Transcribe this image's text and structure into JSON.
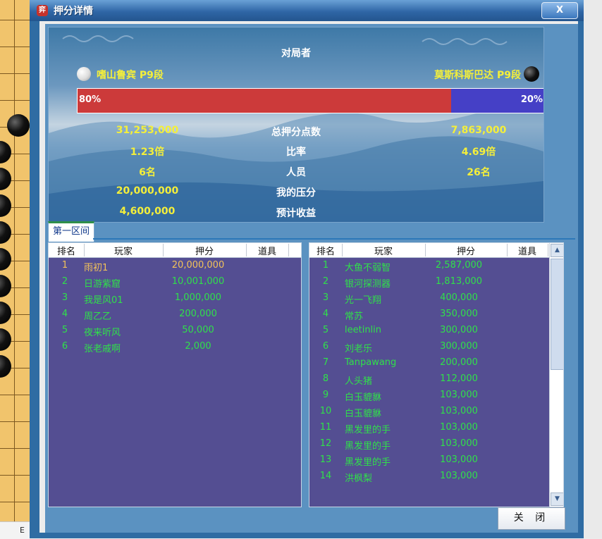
{
  "board": {
    "status_letter": "E"
  },
  "dialog": {
    "title": "押分详情",
    "title_icon_glyph": "弈",
    "close_x": "X",
    "close_button": "关 闭"
  },
  "summary": {
    "header": "对局者",
    "player_white": "嗜山鲁宾 P9段",
    "player_black": "莫斯科斯巴达 P9段",
    "ratio_left": 0.8,
    "ratio_left_label": "80%",
    "ratio_right_label": "20%",
    "rows": [
      {
        "label": "总押分点数",
        "left": "31,253,000",
        "right": "7,863,000"
      },
      {
        "label": "比率",
        "left": "1.23倍",
        "right": "4.69倍"
      },
      {
        "label": "人员",
        "left": "6名",
        "right": "26名"
      },
      {
        "label": "我的压分",
        "left": "20,000,000",
        "right": ""
      },
      {
        "label": "预计收益",
        "left": "4,600,000",
        "right": ""
      }
    ],
    "colors": {
      "bar_left": "#cc3a3a",
      "bar_right": "#4540c6",
      "value_text": "#f4ef3a"
    }
  },
  "tab": {
    "label": "第一区间"
  },
  "columns": {
    "rank": "排名",
    "player": "玩家",
    "bet": "押分",
    "item": "道具"
  },
  "left_table": [
    {
      "rank": "1",
      "name": "雨初1",
      "bet": "20,000,000",
      "highlight": true
    },
    {
      "rank": "2",
      "name": "日游紫窟",
      "bet": "10,001,000"
    },
    {
      "rank": "3",
      "name": "我是风01",
      "bet": "1,000,000"
    },
    {
      "rank": "4",
      "name": "周乙乙",
      "bet": "200,000"
    },
    {
      "rank": "5",
      "name": "夜来听风",
      "bet": "50,000"
    },
    {
      "rank": "6",
      "name": "张老戚啊",
      "bet": "2,000"
    }
  ],
  "right_table": [
    {
      "rank": "1",
      "name": "大鱼不弱智",
      "bet": "2,587,000"
    },
    {
      "rank": "2",
      "name": "银河探测器",
      "bet": "1,813,000"
    },
    {
      "rank": "3",
      "name": "光一飞翔",
      "bet": "400,000"
    },
    {
      "rank": "4",
      "name": "常苏",
      "bet": "350,000"
    },
    {
      "rank": "5",
      "name": "leetinlin",
      "bet": "300,000"
    },
    {
      "rank": "6",
      "name": "刘老乐",
      "bet": "300,000"
    },
    {
      "rank": "7",
      "name": "Tanpawang",
      "bet": "200,000"
    },
    {
      "rank": "8",
      "name": "人头猪",
      "bet": "112,000"
    },
    {
      "rank": "9",
      "name": "白玉貔貅",
      "bet": "103,000"
    },
    {
      "rank": "10",
      "name": "白玉貔貅",
      "bet": "103,000"
    },
    {
      "rank": "11",
      "name": "黑发里的手",
      "bet": "103,000"
    },
    {
      "rank": "12",
      "name": "黑发里的手",
      "bet": "103,000"
    },
    {
      "rank": "13",
      "name": "黑发里的手",
      "bet": "103,000"
    },
    {
      "rank": "14",
      "name": "洪枫梨",
      "bet": "103,000"
    }
  ]
}
